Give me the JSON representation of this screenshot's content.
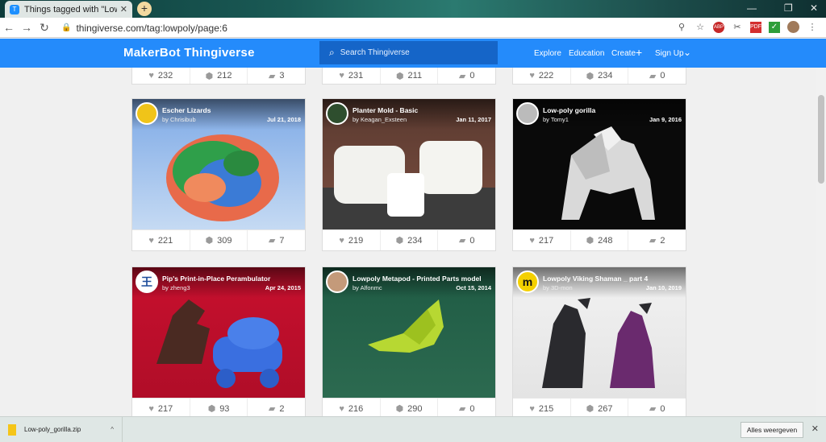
{
  "browser": {
    "tab_title": "Things tagged with \"Lowpoly\" - T",
    "tab_close": "✕",
    "new_tab": "+",
    "url": "thingiverse.com/tag:lowpoly/page:6",
    "win_minimize": "—",
    "win_restore": "❐",
    "win_close": "✕",
    "abp_badge": "ABP",
    "pdf_ext": "PDF"
  },
  "site": {
    "logo": "MakerBot Thingiverse",
    "search_placeholder": "Search Thingiverse",
    "nav": {
      "explore": "Explore",
      "education": "Education",
      "create": "Create",
      "create_plus": "+",
      "signup": "Sign Up",
      "signup_caret": "⌄"
    }
  },
  "top_stats": [
    {
      "likes": "232",
      "collects": "212",
      "comments": "3"
    },
    {
      "likes": "231",
      "collects": "211",
      "comments": "0"
    },
    {
      "likes": "222",
      "collects": "234",
      "comments": "0"
    }
  ],
  "cards": [
    {
      "title": "Escher Lizards",
      "by": "by Chrisibub",
      "date": "Jul 21, 2018",
      "likes": "221",
      "collects": "309",
      "comments": "7"
    },
    {
      "title": "Planter Mold - Basic",
      "by": "by Keagan_Exsteen",
      "date": "Jan 11, 2017",
      "likes": "219",
      "collects": "234",
      "comments": "0"
    },
    {
      "title": "Low-poly gorilla",
      "by": "by Tomy1",
      "date": "Jan 9, 2016",
      "likes": "217",
      "collects": "248",
      "comments": "2"
    },
    {
      "title": "Pip's Print-in-Place Perambulator",
      "by": "by zheng3",
      "date": "Apr 24, 2015",
      "likes": "217",
      "collects": "93",
      "comments": "2"
    },
    {
      "title": "Lowpoly Metapod - Printed Parts model",
      "by": "by Alfonmc",
      "date": "Oct 15, 2014",
      "likes": "216",
      "collects": "290",
      "comments": "0"
    },
    {
      "title": "Lowpoly Viking Shaman _ part 4",
      "by": "by 3D-mon",
      "date": "Jan 10, 2019",
      "likes": "215",
      "collects": "267",
      "comments": "0"
    }
  ],
  "avatar_glyphs": {
    "zheng3": "王",
    "threedmon": "m"
  },
  "download": {
    "filename": "Low-poly_gorilla.zip",
    "caret": "^",
    "show_all": "Alles weergeven",
    "close": "✕"
  }
}
